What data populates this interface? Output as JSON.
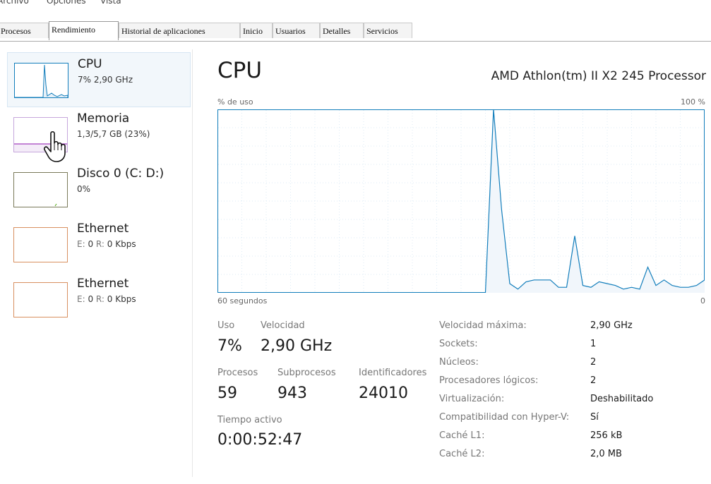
{
  "menu": [
    "Archivo",
    "Opciones",
    "Vista"
  ],
  "tabs": [
    "Procesos",
    "Rendimiento",
    "Historial de aplicaciones",
    "Inicio",
    "Usuarios",
    "Detalles",
    "Servicios"
  ],
  "sidebar": [
    {
      "title": "CPU",
      "sub": "7% 2,90 GHz",
      "color": "#117dbb"
    },
    {
      "title": "Memoria",
      "sub": "1,3/5,7 GB (23%)",
      "color": "#8b12ae"
    },
    {
      "title": "Disco 0 (C: D:)",
      "sub": "0%",
      "color": "#4da60c"
    },
    {
      "title": "Ethernet",
      "e_lbl": "E:",
      "e_val": "0",
      "r_lbl": "R:",
      "r_val": "0 Kbps",
      "color": "#a74f01"
    },
    {
      "title": "Ethernet",
      "e_lbl": "E:",
      "e_val": "0",
      "r_lbl": "R:",
      "r_val": "0 Kbps",
      "color": "#a74f01"
    }
  ],
  "main": {
    "title": "CPU",
    "processor": "AMD Athlon(tm) II X2 245 Processor",
    "graph_top_left": "% de uso",
    "graph_top_right": "100 %",
    "graph_bottom_left": "60 segundos",
    "graph_bottom_right": "0",
    "graph_color": "#117dbb"
  },
  "stats": {
    "uso_label": "Uso",
    "uso_value": "7%",
    "velocidad_label": "Velocidad",
    "velocidad_value": "2,90 GHz",
    "procesos_label": "Procesos",
    "procesos_value": "59",
    "subprocesos_label": "Subprocesos",
    "subprocesos_value": "943",
    "identificadores_label": "Identificadores",
    "identificadores_value": "24010",
    "tiempo_label": "Tiempo activo",
    "tiempo_value": "0:00:52:47"
  },
  "details": [
    {
      "label": "Velocidad máxima:",
      "value": "2,90 GHz"
    },
    {
      "label": "Sockets:",
      "value": "1"
    },
    {
      "label": "Núcleos:",
      "value": "2"
    },
    {
      "label": "Procesadores lógicos:",
      "value": "2"
    },
    {
      "label": "Virtualización:",
      "value": "Deshabilitado"
    },
    {
      "label": "Compatibilidad con Hyper-V:",
      "value": "Sí"
    },
    {
      "label": "Caché L1:",
      "value": "256 kB"
    },
    {
      "label": "Caché L2:",
      "value": "2,0 MB"
    }
  ],
  "chart_data": {
    "type": "line",
    "xlabel": "60 segundos",
    "ylabel": "% de uso",
    "xlim": [
      60,
      0
    ],
    "ylim": [
      0,
      100
    ],
    "x": [
      60,
      59,
      58,
      57,
      56,
      55,
      54,
      53,
      52,
      51,
      50,
      49,
      48,
      47,
      46,
      45,
      44,
      43,
      42,
      41,
      40,
      39,
      38,
      37,
      36,
      35,
      34,
      33,
      32,
      31,
      30,
      29,
      28,
      27,
      26,
      25,
      24,
      23,
      22,
      21,
      20,
      19,
      18,
      17,
      16,
      15,
      14,
      13,
      12,
      11,
      10,
      9,
      8,
      7,
      6,
      5,
      4,
      3,
      2,
      1,
      0
    ],
    "series": [
      {
        "values": [
          0,
          0,
          0,
          0,
          0,
          0,
          0,
          0,
          0,
          0,
          0,
          0,
          0,
          0,
          0,
          0,
          0,
          0,
          0,
          0,
          0,
          0,
          0,
          0,
          0,
          0,
          0,
          0,
          0,
          0,
          0,
          0,
          0,
          0,
          100,
          45,
          5,
          2,
          6,
          7,
          7,
          7,
          3,
          3,
          31,
          4,
          3,
          6,
          5,
          4,
          2,
          3,
          2,
          14,
          4,
          7,
          4,
          3,
          3,
          4,
          7
        ]
      }
    ]
  }
}
